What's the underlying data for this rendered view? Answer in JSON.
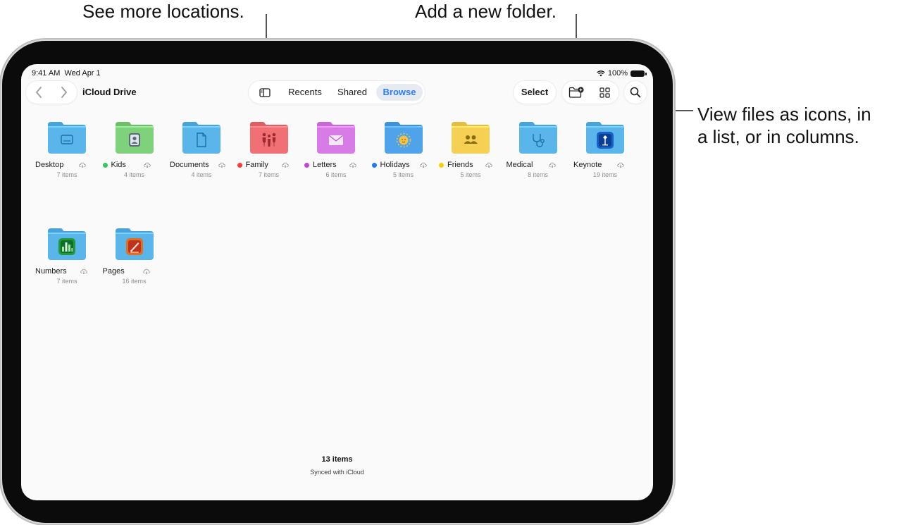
{
  "callouts": {
    "locations": "See more locations.",
    "new_folder": "Add a new folder.",
    "view_line1": "View files as icons, in",
    "view_line2": "a list, or in columns."
  },
  "status_bar": {
    "time": "9:41 AM",
    "date": "Wed Apr 1",
    "battery": "100%"
  },
  "toolbar": {
    "title": "iCloud Drive",
    "tabs": [
      {
        "label": "Recents",
        "active": false
      },
      {
        "label": "Shared",
        "active": false
      },
      {
        "label": "Browse",
        "active": true
      }
    ],
    "select_label": "Select",
    "icons": [
      "back-icon",
      "forward-icon",
      "sidebar-icon",
      "new-folder-icon",
      "grid-view-icon",
      "search-icon"
    ]
  },
  "folders": [
    {
      "name": "Desktop",
      "count": "7 items",
      "tag": "",
      "color": "#5ab6ea",
      "icon": "desktop-icon"
    },
    {
      "name": "Kids",
      "count": "4 items",
      "tag": "#34c759",
      "color": "#7fd17c",
      "icon": "contacts-icon"
    },
    {
      "name": "Documents",
      "count": "4 items",
      "tag": "",
      "color": "#5ab6ea",
      "icon": "document-icon"
    },
    {
      "name": "Family",
      "count": "7 items",
      "tag": "#ff3b30",
      "color": "#f07075",
      "icon": "family-icon"
    },
    {
      "name": "Letters",
      "count": "6 items",
      "tag": "#c344d6",
      "color": "#d77be6",
      "icon": "envelope-icon"
    },
    {
      "name": "Holidays",
      "count": "5 items",
      "tag": "#1e7cf0",
      "color": "#4ea3ea",
      "icon": "sun-icon"
    },
    {
      "name": "Friends",
      "count": "5 items",
      "tag": "#ffcc00",
      "color": "#f6d052",
      "icon": "people-icon"
    },
    {
      "name": "Medical",
      "count": "8 items",
      "tag": "",
      "color": "#5ab6ea",
      "icon": "stethoscope-icon"
    },
    {
      "name": "Keynote",
      "count": "19 items",
      "tag": "",
      "color": "#5ab6ea",
      "icon": "keynote-app-icon"
    },
    {
      "name": "Numbers",
      "count": "7 items",
      "tag": "",
      "color": "#5ab6ea",
      "icon": "numbers-app-icon"
    },
    {
      "name": "Pages",
      "count": "16 items",
      "tag": "",
      "color": "#5ab6ea",
      "icon": "pages-app-icon"
    }
  ],
  "footer": {
    "count": "13 items",
    "sync": "Synced with iCloud"
  }
}
